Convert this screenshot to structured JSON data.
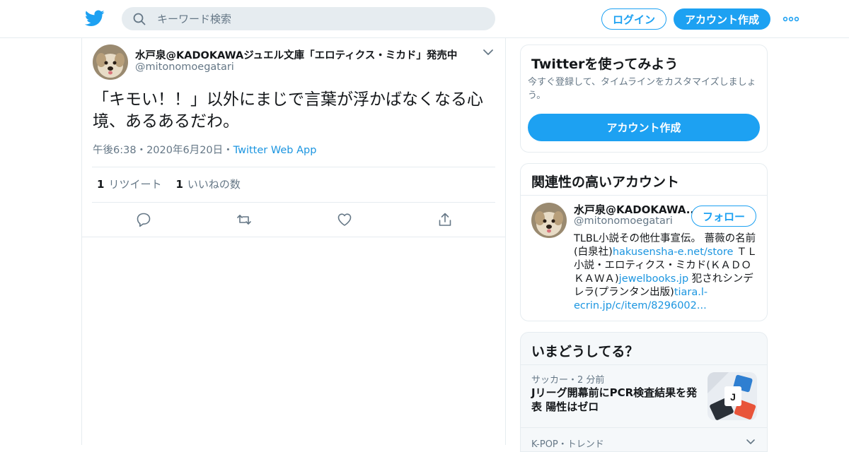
{
  "header": {
    "search_placeholder": "キーワード検索",
    "login_label": "ログイン",
    "signup_label": "アカウント作成",
    "brand_color": "#1da1f2"
  },
  "tweet": {
    "author_name": "水戸泉@KADOKAWAジュエル文庫「エロティクス・ミカド」発売中",
    "author_handle": "@mitonomoegatari",
    "text": "「キモい！！」以外にまじで言葉が浮かばなくなる心境、あるあるだわ。",
    "time": "午後6:38",
    "date": "2020年6月20日",
    "dot": "・",
    "source_app": "Twitter Web App",
    "retweet_count": "1",
    "retweet_label": "リツイート",
    "like_count": "1",
    "like_label": "いいねの数"
  },
  "signup_card": {
    "title": "Twitterを使ってみよう",
    "subtitle": "今すぐ登録して、タイムラインをカスタマイズしましょう。",
    "button_label": "アカウント作成"
  },
  "related": {
    "title": "関連性の高いアカウント",
    "name": "水戸泉@KADOKAWA...",
    "handle": "@mitonomoegatari",
    "follow_label": "フォロー",
    "bio_1": "TLBL小説その他仕事宣伝。 薔薇の名前(白泉社)",
    "bio_link_1": "hakusensha-e.net/store",
    "bio_2": " ＴＬ小説・エロティクス・ミカド(ＫＡＤＯＫＡＷＡ)",
    "bio_link_2": "jewelbooks.jp",
    "bio_3": " 犯されシンデレラ(プランタン出版)",
    "bio_link_3": "tiara.l-ecrin.jp/c/item/8296002..."
  },
  "trends": {
    "title": "いまどうしてる？",
    "items": [
      {
        "meta": "サッカー・2 分前",
        "title": "Jリーグ開幕前にPCR検査結果を発表 陽性はゼロ"
      },
      {
        "meta": "K-POP・トレンド"
      }
    ]
  }
}
